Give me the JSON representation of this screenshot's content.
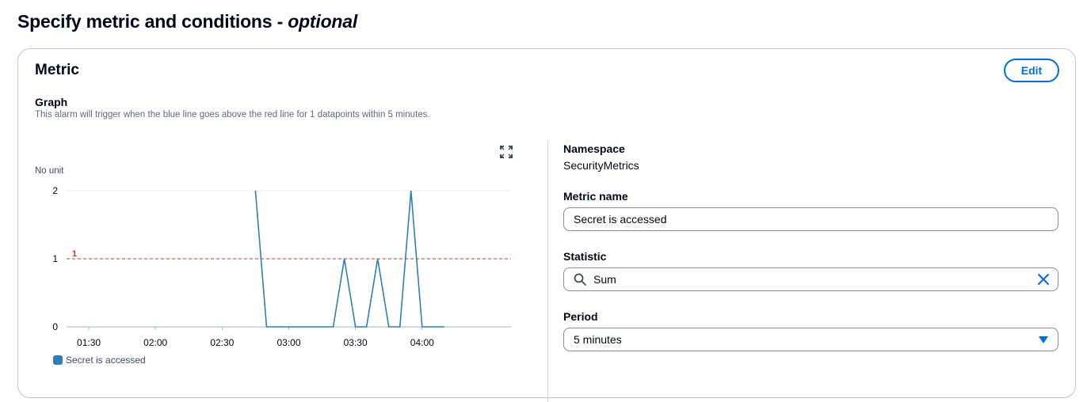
{
  "page": {
    "title": "Specify metric and conditions - ",
    "title_optional": "optional"
  },
  "metric_section": {
    "title": "Metric",
    "edit_label": "Edit",
    "graph_label": "Graph",
    "graph_description": "This alarm will trigger when the blue line goes above the red line for 1 datapoints within 5 minutes."
  },
  "details": {
    "namespace_label": "Namespace",
    "namespace_value": "SecurityMetrics",
    "metric_name_label": "Metric name",
    "metric_name_value": "Secret is accessed",
    "statistic_label": "Statistic",
    "statistic_value": "Sum",
    "period_label": "Period",
    "period_value": "5 minutes"
  },
  "icons": {
    "expand": "expand-icon",
    "search": "search-icon",
    "clear": "close-icon",
    "dropdown": "caret-down-icon"
  },
  "colors": {
    "series": "#2e7fb8",
    "threshold": "#c0392b",
    "accent": "#006ce0"
  },
  "chart_data": {
    "type": "line",
    "ylabel": "No unit",
    "ylim": [
      0,
      2
    ],
    "yticks": [
      0,
      1,
      2
    ],
    "xlim": [
      "01:20",
      "04:40"
    ],
    "xticks": [
      "01:30",
      "02:00",
      "02:30",
      "03:00",
      "03:30",
      "04:00"
    ],
    "grid": true,
    "legend_position": "bottom-left",
    "threshold": {
      "value": 1,
      "label": "1"
    },
    "series": [
      {
        "name": "Secret is accessed",
        "x": [
          "02:45",
          "02:50",
          "03:05",
          "03:10",
          "03:15",
          "03:20",
          "03:25",
          "03:30",
          "03:35",
          "03:40",
          "03:45",
          "03:50",
          "03:55",
          "04:00",
          "04:05",
          "04:10"
        ],
        "y": [
          2,
          0,
          0,
          0,
          0,
          0,
          1,
          0,
          0,
          1,
          0,
          0,
          2,
          0,
          0,
          0
        ]
      }
    ]
  }
}
